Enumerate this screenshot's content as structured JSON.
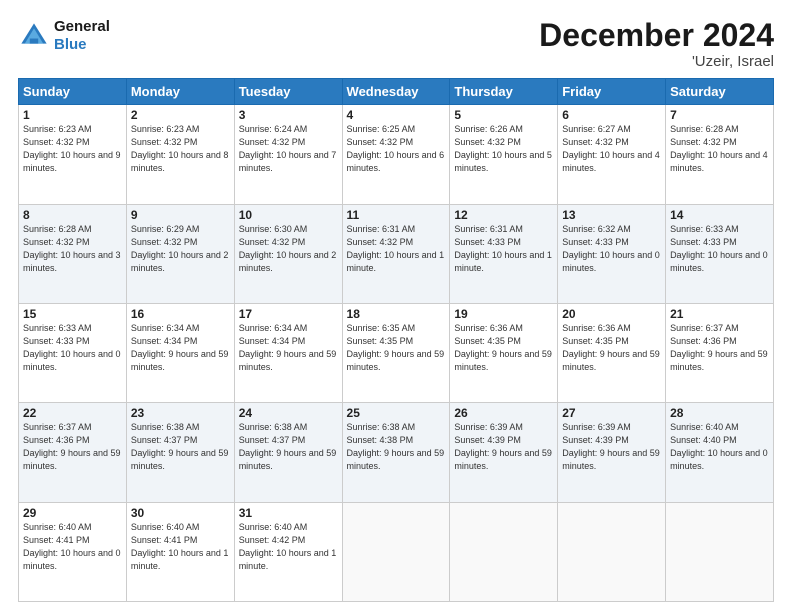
{
  "header": {
    "logo_line1": "General",
    "logo_line2": "Blue",
    "title": "December 2024",
    "subtitle": "'Uzeir, Israel"
  },
  "days_of_week": [
    "Sunday",
    "Monday",
    "Tuesday",
    "Wednesday",
    "Thursday",
    "Friday",
    "Saturday"
  ],
  "weeks": [
    [
      {
        "day": "1",
        "sunrise": "6:23 AM",
        "sunset": "4:32 PM",
        "daylight": "10 hours and 9 minutes."
      },
      {
        "day": "2",
        "sunrise": "6:23 AM",
        "sunset": "4:32 PM",
        "daylight": "10 hours and 8 minutes."
      },
      {
        "day": "3",
        "sunrise": "6:24 AM",
        "sunset": "4:32 PM",
        "daylight": "10 hours and 7 minutes."
      },
      {
        "day": "4",
        "sunrise": "6:25 AM",
        "sunset": "4:32 PM",
        "daylight": "10 hours and 6 minutes."
      },
      {
        "day": "5",
        "sunrise": "6:26 AM",
        "sunset": "4:32 PM",
        "daylight": "10 hours and 5 minutes."
      },
      {
        "day": "6",
        "sunrise": "6:27 AM",
        "sunset": "4:32 PM",
        "daylight": "10 hours and 4 minutes."
      },
      {
        "day": "7",
        "sunrise": "6:28 AM",
        "sunset": "4:32 PM",
        "daylight": "10 hours and 4 minutes."
      }
    ],
    [
      {
        "day": "8",
        "sunrise": "6:28 AM",
        "sunset": "4:32 PM",
        "daylight": "10 hours and 3 minutes."
      },
      {
        "day": "9",
        "sunrise": "6:29 AM",
        "sunset": "4:32 PM",
        "daylight": "10 hours and 2 minutes."
      },
      {
        "day": "10",
        "sunrise": "6:30 AM",
        "sunset": "4:32 PM",
        "daylight": "10 hours and 2 minutes."
      },
      {
        "day": "11",
        "sunrise": "6:31 AM",
        "sunset": "4:32 PM",
        "daylight": "10 hours and 1 minute."
      },
      {
        "day": "12",
        "sunrise": "6:31 AM",
        "sunset": "4:33 PM",
        "daylight": "10 hours and 1 minute."
      },
      {
        "day": "13",
        "sunrise": "6:32 AM",
        "sunset": "4:33 PM",
        "daylight": "10 hours and 0 minutes."
      },
      {
        "day": "14",
        "sunrise": "6:33 AM",
        "sunset": "4:33 PM",
        "daylight": "10 hours and 0 minutes."
      }
    ],
    [
      {
        "day": "15",
        "sunrise": "6:33 AM",
        "sunset": "4:33 PM",
        "daylight": "10 hours and 0 minutes."
      },
      {
        "day": "16",
        "sunrise": "6:34 AM",
        "sunset": "4:34 PM",
        "daylight": "9 hours and 59 minutes."
      },
      {
        "day": "17",
        "sunrise": "6:34 AM",
        "sunset": "4:34 PM",
        "daylight": "9 hours and 59 minutes."
      },
      {
        "day": "18",
        "sunrise": "6:35 AM",
        "sunset": "4:35 PM",
        "daylight": "9 hours and 59 minutes."
      },
      {
        "day": "19",
        "sunrise": "6:36 AM",
        "sunset": "4:35 PM",
        "daylight": "9 hours and 59 minutes."
      },
      {
        "day": "20",
        "sunrise": "6:36 AM",
        "sunset": "4:35 PM",
        "daylight": "9 hours and 59 minutes."
      },
      {
        "day": "21",
        "sunrise": "6:37 AM",
        "sunset": "4:36 PM",
        "daylight": "9 hours and 59 minutes."
      }
    ],
    [
      {
        "day": "22",
        "sunrise": "6:37 AM",
        "sunset": "4:36 PM",
        "daylight": "9 hours and 59 minutes."
      },
      {
        "day": "23",
        "sunrise": "6:38 AM",
        "sunset": "4:37 PM",
        "daylight": "9 hours and 59 minutes."
      },
      {
        "day": "24",
        "sunrise": "6:38 AM",
        "sunset": "4:37 PM",
        "daylight": "9 hours and 59 minutes."
      },
      {
        "day": "25",
        "sunrise": "6:38 AM",
        "sunset": "4:38 PM",
        "daylight": "9 hours and 59 minutes."
      },
      {
        "day": "26",
        "sunrise": "6:39 AM",
        "sunset": "4:39 PM",
        "daylight": "9 hours and 59 minutes."
      },
      {
        "day": "27",
        "sunrise": "6:39 AM",
        "sunset": "4:39 PM",
        "daylight": "9 hours and 59 minutes."
      },
      {
        "day": "28",
        "sunrise": "6:40 AM",
        "sunset": "4:40 PM",
        "daylight": "10 hours and 0 minutes."
      }
    ],
    [
      {
        "day": "29",
        "sunrise": "6:40 AM",
        "sunset": "4:41 PM",
        "daylight": "10 hours and 0 minutes."
      },
      {
        "day": "30",
        "sunrise": "6:40 AM",
        "sunset": "4:41 PM",
        "daylight": "10 hours and 1 minute."
      },
      {
        "day": "31",
        "sunrise": "6:40 AM",
        "sunset": "4:42 PM",
        "daylight": "10 hours and 1 minute."
      },
      null,
      null,
      null,
      null
    ]
  ],
  "labels": {
    "sunrise": "Sunrise:",
    "sunset": "Sunset:",
    "daylight": "Daylight:"
  }
}
